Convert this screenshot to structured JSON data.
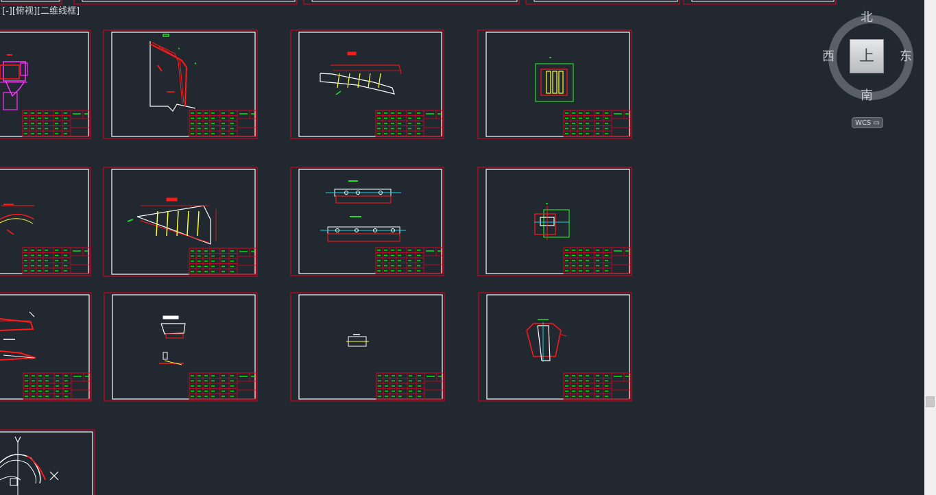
{
  "view": {
    "label": "[-][俯视][二维线框]"
  },
  "viewcube": {
    "north": "北",
    "south": "南",
    "west": "西",
    "east": "东",
    "face": "上",
    "wcs": "WCS ▭"
  },
  "colors": {
    "background": "#212830",
    "sheet_border": "#e3001b",
    "inner_frame": "#ffffff",
    "title_block": "#e3001b",
    "title_text": "#00e000",
    "drawing_red": "#ff1a1a",
    "drawing_green": "#22e022",
    "drawing_yellow": "#ffff33",
    "drawing_cyan": "#19d2e6",
    "drawing_magenta": "#ff33ff",
    "drawing_white": "#ffffff"
  },
  "sheets": [
    {
      "id": "sheet-r1c0",
      "content": "magenta-structure"
    },
    {
      "id": "sheet-r1c1",
      "content": "retaining-wall-section"
    },
    {
      "id": "sheet-r1c2",
      "content": "sloped-beam"
    },
    {
      "id": "sheet-r1c3",
      "content": "column-section"
    },
    {
      "id": "sheet-r2c0",
      "content": "curved-segment"
    },
    {
      "id": "sheet-r2c1",
      "content": "tapered-girder"
    },
    {
      "id": "sheet-r2c2",
      "content": "plates-with-holes"
    },
    {
      "id": "sheet-r2c3",
      "content": "node-detail"
    },
    {
      "id": "sheet-r3c0",
      "content": "red-truss-details"
    },
    {
      "id": "sheet-r3c1",
      "content": "small-part-details"
    },
    {
      "id": "sheet-r3c2",
      "content": "small-block"
    },
    {
      "id": "sheet-r3c3",
      "content": "funnel-section"
    },
    {
      "id": "sheet-r4c0",
      "content": "circular-plan"
    }
  ]
}
